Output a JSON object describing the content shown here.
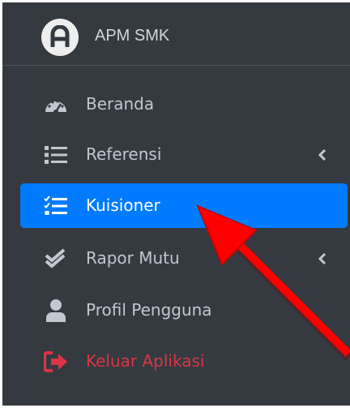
{
  "brand": {
    "name": "APM SMK",
    "logo_letter": "A",
    "icon": "brand-logo-icon"
  },
  "nav": {
    "items": [
      {
        "label": "Beranda",
        "icon": "dashboard-gauge-icon"
      },
      {
        "label": "Referensi",
        "icon": "list-icon",
        "has_submenu": true
      },
      {
        "label": "Kuisioner",
        "icon": "tasks-checklist-icon",
        "active": true
      },
      {
        "label": "Rapor Mutu",
        "icon": "check-double-icon",
        "has_submenu": true
      },
      {
        "label": "Profil Pengguna",
        "icon": "user-icon"
      },
      {
        "label": "Keluar Aplikasi",
        "icon": "sign-out-icon",
        "color": "#dc3545"
      }
    ]
  },
  "colors": {
    "sidebar_bg": "#343a40",
    "active_bg": "#007bff",
    "text": "#c2c7d0",
    "logout": "#dc3545",
    "annotation_arrow": "#ff0000"
  },
  "annotation": {
    "type": "arrow",
    "points_to": "Kuisioner"
  }
}
